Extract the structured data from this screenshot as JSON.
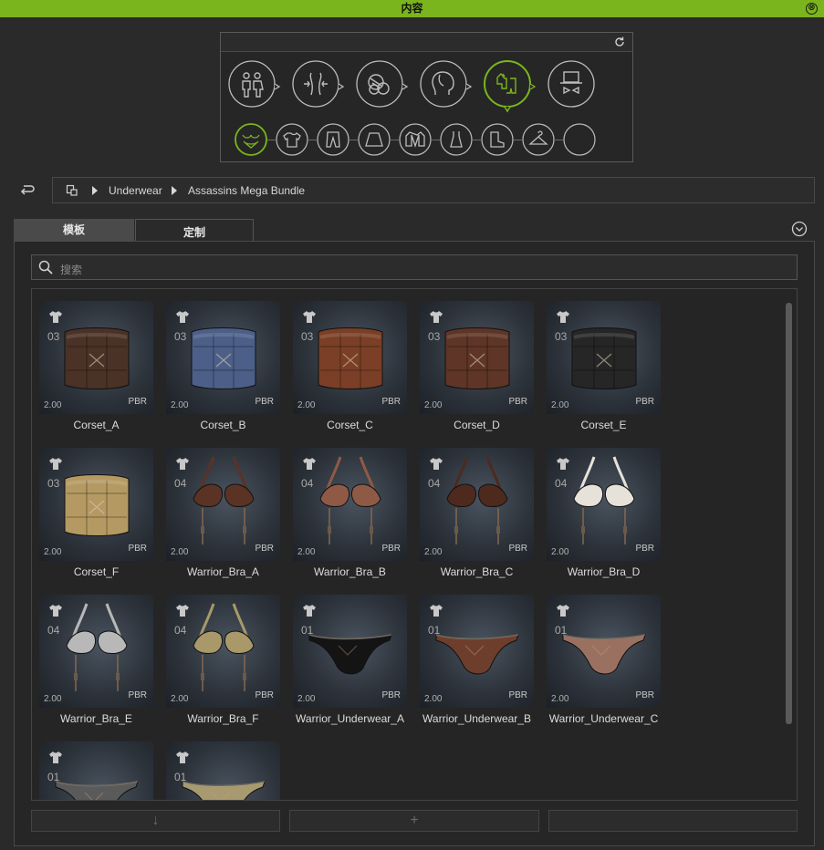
{
  "window": {
    "title": "内容",
    "close_glyph": "⊗"
  },
  "category_panel": {
    "big_icons": [
      {
        "name": "people-category-icon",
        "selected": false
      },
      {
        "name": "body-morph-icon",
        "selected": false
      },
      {
        "name": "material-balls-icon",
        "selected": false
      },
      {
        "name": "head-profile-icon",
        "selected": false
      },
      {
        "name": "clothing-category-icon",
        "selected": true
      },
      {
        "name": "hat-bowtie-icon",
        "selected": false
      }
    ],
    "small_icons": [
      {
        "name": "underwear-bra-icon",
        "selected": true
      },
      {
        "name": "tshirt-icon",
        "selected": false
      },
      {
        "name": "pants-icon",
        "selected": false
      },
      {
        "name": "skirt-icon",
        "selected": false
      },
      {
        "name": "jacket-icon",
        "selected": false
      },
      {
        "name": "dress-icon",
        "selected": false
      },
      {
        "name": "boot-icon",
        "selected": false
      },
      {
        "name": "hanger-icon",
        "selected": false
      },
      {
        "name": "empty-slot-icon",
        "selected": false
      }
    ]
  },
  "breadcrumb": {
    "items": [
      "Underwear",
      "Assassins Mega Bundle"
    ]
  },
  "tabs": [
    {
      "label": "模板",
      "active": true
    },
    {
      "label": "定制",
      "active": false
    }
  ],
  "search": {
    "placeholder": "搜索"
  },
  "items": [
    {
      "name": "Corset_A",
      "count": "03",
      "version": "2.00",
      "badge": "PBR",
      "kind": "corset",
      "color": "#4a3226"
    },
    {
      "name": "Corset_B",
      "count": "03",
      "version": "2.00",
      "badge": "PBR",
      "kind": "corset",
      "color": "#4c5f88"
    },
    {
      "name": "Corset_C",
      "count": "03",
      "version": "2.00",
      "badge": "PBR",
      "kind": "corset",
      "color": "#7a3f26"
    },
    {
      "name": "Corset_D",
      "count": "03",
      "version": "2.00",
      "badge": "PBR",
      "kind": "corset",
      "color": "#5e3526"
    },
    {
      "name": "Corset_E",
      "count": "03",
      "version": "2.00",
      "badge": "PBR",
      "kind": "corset",
      "color": "#262626"
    },
    {
      "name": "Corset_F",
      "count": "03",
      "version": "2.00",
      "badge": "PBR",
      "kind": "corset",
      "color": "#b49a62"
    },
    {
      "name": "Warrior_Bra_A",
      "count": "04",
      "version": "2.00",
      "badge": "PBR",
      "kind": "bra",
      "color": "#5b3324"
    },
    {
      "name": "Warrior_Bra_B",
      "count": "04",
      "version": "2.00",
      "badge": "PBR",
      "kind": "bra",
      "color": "#8e5a46"
    },
    {
      "name": "Warrior_Bra_C",
      "count": "04",
      "version": "2.00",
      "badge": "PBR",
      "kind": "bra",
      "color": "#4e2a1e"
    },
    {
      "name": "Warrior_Bra_D",
      "count": "04",
      "version": "2.00",
      "badge": "PBR",
      "kind": "bra",
      "color": "#e6e2da"
    },
    {
      "name": "Warrior_Bra_E",
      "count": "04",
      "version": "2.00",
      "badge": "PBR",
      "kind": "bra",
      "color": "#b8b8b8"
    },
    {
      "name": "Warrior_Bra_F",
      "count": "04",
      "version": "2.00",
      "badge": "PBR",
      "kind": "bra",
      "color": "#a8986a"
    },
    {
      "name": "Warrior_Underwear_A",
      "count": "01",
      "version": "2.00",
      "badge": "PBR",
      "kind": "thong",
      "color": "#141414"
    },
    {
      "name": "Warrior_Underwear_B",
      "count": "01",
      "version": "2.00",
      "badge": "PBR",
      "kind": "thong",
      "color": "#6e3e2c"
    },
    {
      "name": "Warrior_Underwear_C",
      "count": "01",
      "version": "2.00",
      "badge": "PBR",
      "kind": "thong",
      "color": "#9a7060"
    },
    {
      "name": "",
      "count": "01",
      "version": "",
      "badge": "",
      "kind": "thong",
      "color": "#5a5a5a"
    },
    {
      "name": "",
      "count": "01",
      "version": "",
      "badge": "",
      "kind": "thong",
      "color": "#a89a70"
    }
  ],
  "bottom_buttons": [
    {
      "name": "download-button",
      "glyph": "↓"
    },
    {
      "name": "add-button",
      "glyph": "+"
    },
    {
      "name": "extra-button",
      "glyph": ""
    }
  ],
  "colors": {
    "accent": "#7ab51d",
    "background": "#262626"
  }
}
